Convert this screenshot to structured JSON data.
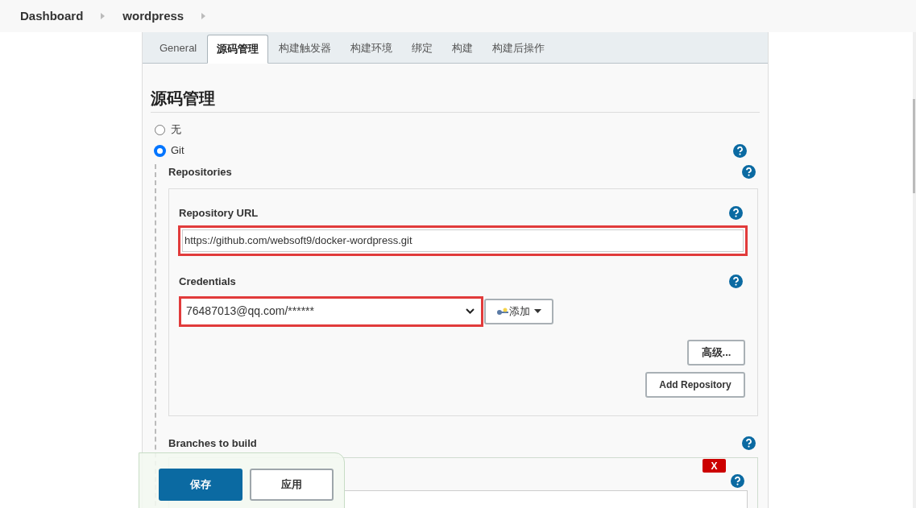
{
  "breadcrumbs": [
    {
      "label": "Dashboard"
    },
    {
      "label": "wordpress"
    }
  ],
  "tabs": [
    {
      "label": "General",
      "selected": false
    },
    {
      "label": "源码管理",
      "selected": true
    },
    {
      "label": "构建触发器",
      "selected": false
    },
    {
      "label": "构建环境",
      "selected": false
    },
    {
      "label": "绑定",
      "selected": false
    },
    {
      "label": "构建",
      "selected": false
    },
    {
      "label": "构建后操作",
      "selected": false
    }
  ],
  "section_title": "源码管理",
  "scm_options": [
    {
      "label": "无",
      "selected": false
    },
    {
      "label": "Git",
      "selected": true
    }
  ],
  "repositories": {
    "label": "Repositories",
    "url_label": "Repository URL",
    "url_value": "https://github.com/websoft9/docker-wordpress.git",
    "credentials_label": "Credentials",
    "credentials_value": "76487013@qq.com/******",
    "add_button": "添加",
    "advanced_button": "高级...",
    "add_repository_button": "Add Repository"
  },
  "branches": {
    "label": "Branches to build",
    "remove_button": "X"
  },
  "footer": {
    "save_button": "保存",
    "apply_button": "应用"
  }
}
